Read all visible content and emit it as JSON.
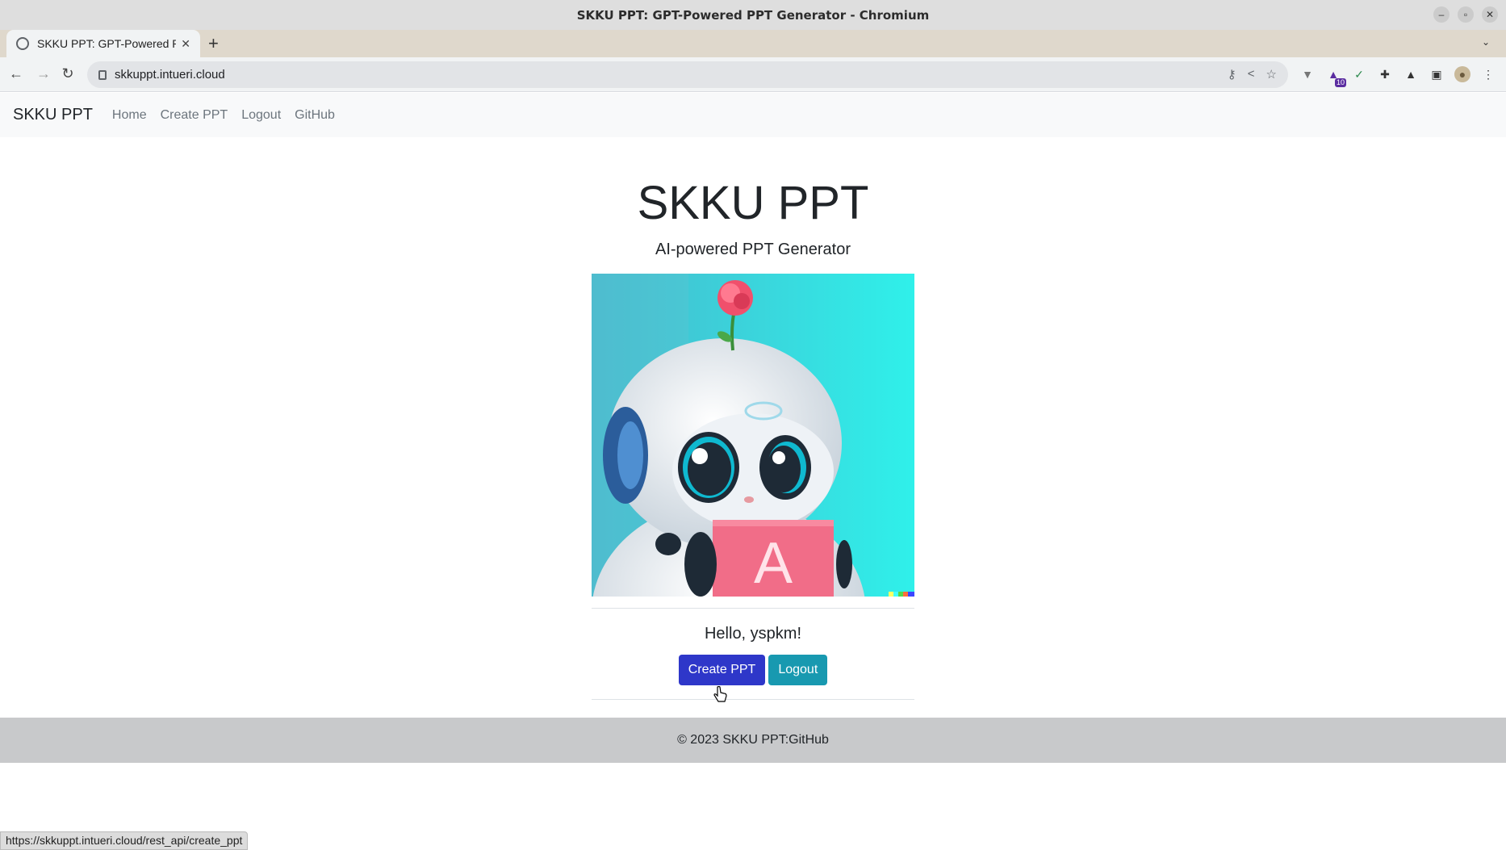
{
  "window": {
    "title": "SKKU PPT: GPT-Powered PPT Generator - Chromium"
  },
  "browser": {
    "tab_title": "SKKU PPT: GPT-Powered PPT Generator",
    "url": "skkuppt.intueri.cloud",
    "extension_badge": "10",
    "status_url": "https://skkuppt.intueri.cloud/rest_api/create_ppt"
  },
  "navbar": {
    "brand": "SKKU PPT",
    "links": [
      "Home",
      "Create PPT",
      "Logout",
      "GitHub"
    ]
  },
  "hero": {
    "title": "SKKU PPT",
    "subtitle": "AI-powered PPT Generator",
    "image_letter": "A",
    "greeting": "Hello, yspkm!",
    "buttons": {
      "create": "Create PPT",
      "logout": "Logout"
    }
  },
  "footer": {
    "copyright": "© 2023 SKKU PPT: ",
    "link": "GitHub"
  },
  "colors": {
    "primary": "#2e37c9",
    "info": "#1899b0",
    "footer_bg": "#c8c9cb"
  }
}
